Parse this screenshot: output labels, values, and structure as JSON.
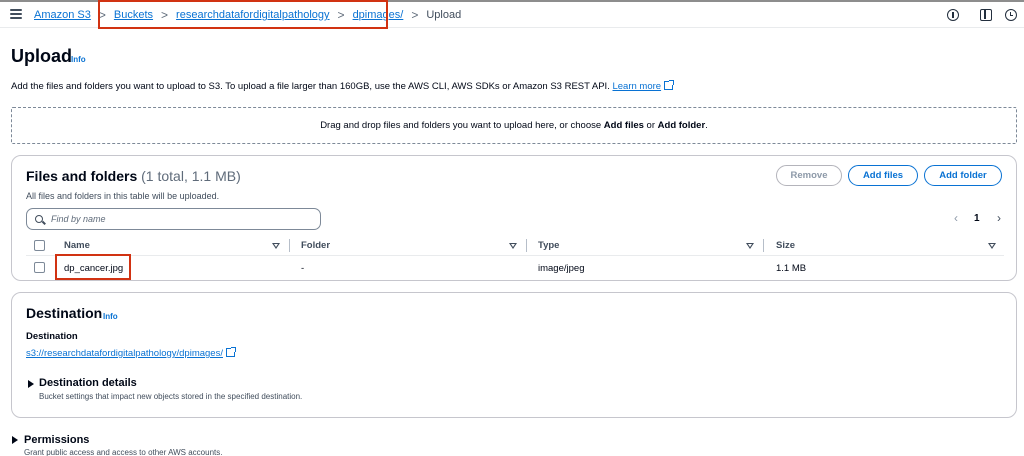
{
  "header": {
    "breadcrumb": [
      "Amazon S3",
      "Buckets",
      "researchdatafordigitalpathology",
      "dpimages/"
    ],
    "current": "Upload",
    "separator": ">",
    "icons": [
      "menu-icon",
      "info-icon",
      "split-panel-icon",
      "recent-icon"
    ]
  },
  "page": {
    "title": "Upload",
    "info_label": "Info",
    "description": "Add the files and folders you want to upload to S3. To upload a file larger than 160GB, use the AWS CLI, AWS SDKs or Amazon S3 REST API.",
    "learn_more": "Learn more"
  },
  "dropzone": {
    "prefix": "Drag and drop files and folders you want to upload here, or choose ",
    "add_files": "Add files",
    "or": " or ",
    "add_folder": "Add folder",
    "suffix": "."
  },
  "files_panel": {
    "title": "Files and folders",
    "count": "(1 total, 1.1 MB)",
    "subtitle": "All files and folders in this table will be uploaded.",
    "buttons": {
      "remove": "Remove",
      "add_files": "Add files",
      "add_folder": "Add folder"
    },
    "search_placeholder": "Find by name",
    "pagination": {
      "prev": "‹",
      "page": "1",
      "next": "›"
    },
    "columns": [
      "Name",
      "Folder",
      "Type",
      "Size"
    ],
    "rows": [
      {
        "name": "dp_cancer.jpg",
        "folder": "-",
        "type": "image/jpeg",
        "size": "1.1 MB"
      }
    ]
  },
  "destination": {
    "title": "Destination",
    "info_label": "Info",
    "label": "Destination",
    "url": "s3://researchdatafordigitalpathology/dpimages/",
    "details_title": "Destination details",
    "details_sub": "Bucket settings that impact new objects stored in the specified destination."
  },
  "permissions": {
    "title": "Permissions",
    "sub": "Grant public access and access to other AWS accounts."
  },
  "colors": {
    "link": "#0972d3",
    "highlight": "#d13212",
    "border": "#c6c6cd",
    "text": "#000716"
  }
}
